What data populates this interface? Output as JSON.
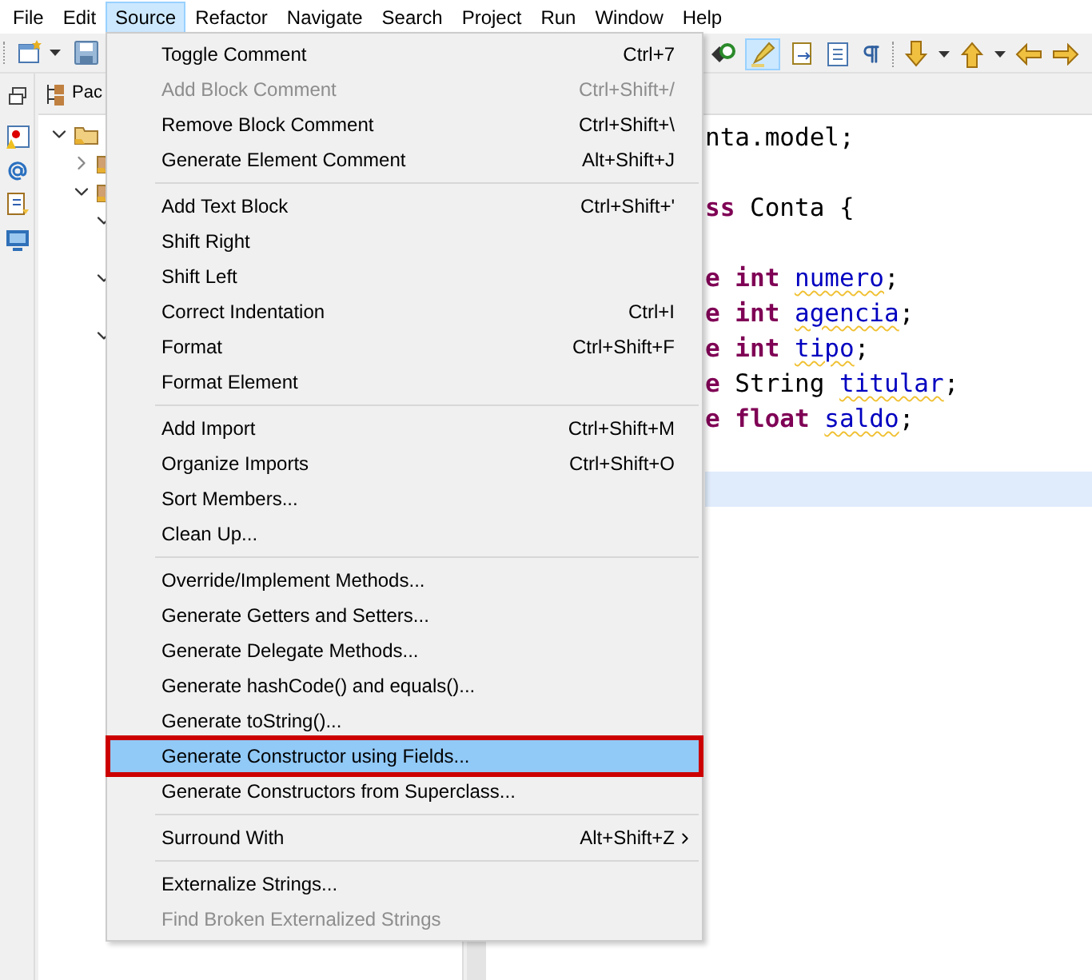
{
  "menubar": [
    {
      "label": "File",
      "selected": false
    },
    {
      "label": "Edit",
      "selected": false
    },
    {
      "label": "Source",
      "selected": true
    },
    {
      "label": "Refactor",
      "selected": false
    },
    {
      "label": "Navigate",
      "selected": false
    },
    {
      "label": "Search",
      "selected": false
    },
    {
      "label": "Project",
      "selected": false
    },
    {
      "label": "Run",
      "selected": false
    },
    {
      "label": "Window",
      "selected": false
    },
    {
      "label": "Help",
      "selected": false
    }
  ],
  "toolbar": {
    "highlight_pressed": true
  },
  "package_explorer": {
    "tab": "Pac",
    "tree": [
      {
        "expanded": true,
        "children": [
          {
            "expanded": false
          },
          {
            "expanded": true,
            "children": [
              {
                "expanded": true
              },
              {
                "expanded": true
              },
              {
                "expanded": true
              }
            ]
          }
        ]
      }
    ]
  },
  "editor": {
    "lines": [
      {
        "current": false,
        "tokens": [
          {
            "text": "nta.model;",
            "kind": "plain"
          }
        ]
      },
      {
        "current": false
      },
      {
        "current": false,
        "tokens": [
          {
            "text": "ss",
            "kind": "keyword"
          },
          {
            "text": " Conta {",
            "kind": "plain"
          }
        ]
      },
      {
        "current": false
      },
      {
        "current": false,
        "tokens": [
          {
            "text": "e int ",
            "kind": "keyword"
          },
          {
            "text": "numero",
            "kind": "field"
          },
          {
            "text": ";",
            "kind": "plain"
          }
        ]
      },
      {
        "current": false,
        "tokens": [
          {
            "text": "e int ",
            "kind": "keyword"
          },
          {
            "text": "agencia",
            "kind": "field"
          },
          {
            "text": ";",
            "kind": "plain"
          }
        ]
      },
      {
        "current": false,
        "tokens": [
          {
            "text": "e int ",
            "kind": "keyword"
          },
          {
            "text": "tipo",
            "kind": "field"
          },
          {
            "text": ";",
            "kind": "plain"
          }
        ]
      },
      {
        "current": false,
        "tokens": [
          {
            "text": "e",
            "kind": "keyword"
          },
          {
            "text": " String ",
            "kind": "plain"
          },
          {
            "text": "titular",
            "kind": "field"
          },
          {
            "text": ";",
            "kind": "plain"
          }
        ]
      },
      {
        "current": false,
        "tokens": [
          {
            "text": "e float ",
            "kind": "keyword"
          },
          {
            "text": "saldo",
            "kind": "field"
          },
          {
            "text": ";",
            "kind": "plain"
          }
        ]
      },
      {
        "current": false
      },
      {
        "current": true
      }
    ]
  },
  "source_menu": {
    "items": [
      {
        "kind": "item",
        "label": "Toggle Comment",
        "shortcut": "Ctrl+7",
        "disabled": false,
        "selected": false
      },
      {
        "kind": "item",
        "label": "Add Block Comment",
        "shortcut": "Ctrl+Shift+/",
        "disabled": true,
        "selected": false
      },
      {
        "kind": "item",
        "label": "Remove Block Comment",
        "shortcut": "Ctrl+Shift+\\",
        "disabled": false,
        "selected": false
      },
      {
        "kind": "item",
        "label": "Generate Element Comment",
        "shortcut": "Alt+Shift+J",
        "disabled": false,
        "selected": false
      },
      {
        "kind": "separator"
      },
      {
        "kind": "item",
        "label": "Add Text Block",
        "shortcut": "Ctrl+Shift+'",
        "disabled": false,
        "selected": false
      },
      {
        "kind": "item",
        "label": "Shift Right",
        "disabled": false,
        "selected": false
      },
      {
        "kind": "item",
        "label": "Shift Left",
        "disabled": false,
        "selected": false
      },
      {
        "kind": "item",
        "label": "Correct Indentation",
        "shortcut": "Ctrl+I",
        "disabled": false,
        "selected": false
      },
      {
        "kind": "item",
        "label": "Format",
        "shortcut": "Ctrl+Shift+F",
        "disabled": false,
        "selected": false
      },
      {
        "kind": "item",
        "label": "Format Element",
        "disabled": false,
        "selected": false
      },
      {
        "kind": "separator"
      },
      {
        "kind": "item",
        "label": "Add Import",
        "shortcut": "Ctrl+Shift+M",
        "disabled": false,
        "selected": false
      },
      {
        "kind": "item",
        "label": "Organize Imports",
        "shortcut": "Ctrl+Shift+O",
        "disabled": false,
        "selected": false
      },
      {
        "kind": "item",
        "label": "Sort Members...",
        "disabled": false,
        "selected": false
      },
      {
        "kind": "item",
        "label": "Clean Up...",
        "disabled": false,
        "selected": false
      },
      {
        "kind": "separator"
      },
      {
        "kind": "item",
        "label": "Override/Implement Methods...",
        "disabled": false,
        "selected": false
      },
      {
        "kind": "item",
        "label": "Generate Getters and Setters...",
        "disabled": false,
        "selected": false
      },
      {
        "kind": "item",
        "label": "Generate Delegate Methods...",
        "disabled": false,
        "selected": false
      },
      {
        "kind": "item",
        "label": "Generate hashCode() and equals()...",
        "disabled": false,
        "selected": false
      },
      {
        "kind": "item",
        "label": "Generate toString()...",
        "disabled": false,
        "selected": false
      },
      {
        "kind": "item",
        "label": "Generate Constructor using Fields...",
        "disabled": false,
        "selected": true
      },
      {
        "kind": "item",
        "label": "Generate Constructors from Superclass...",
        "disabled": false,
        "selected": false
      },
      {
        "kind": "separator"
      },
      {
        "kind": "item",
        "label": "Surround With",
        "shortcut": "Alt+Shift+Z",
        "submenu": true,
        "disabled": false,
        "selected": false
      },
      {
        "kind": "separator"
      },
      {
        "kind": "item",
        "label": "Externalize Strings...",
        "disabled": false,
        "selected": false
      },
      {
        "kind": "item",
        "label": "Find Broken Externalized Strings",
        "disabled": true,
        "selected": false
      }
    ]
  }
}
